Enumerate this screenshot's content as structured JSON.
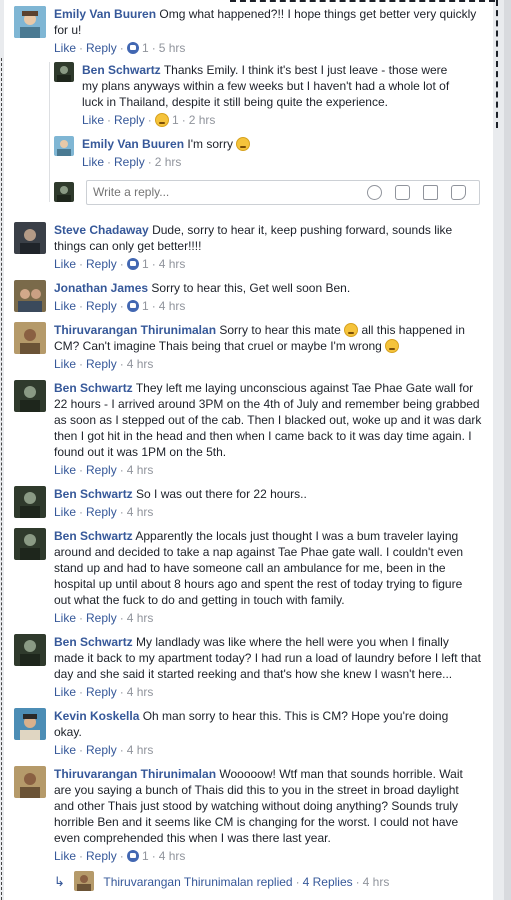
{
  "actions": {
    "like": "Like",
    "reply": "Reply"
  },
  "comments": [
    {
      "name": "Emily Van Buuren",
      "text": "Omg what happened?!! I hope things get better very quickly for u!",
      "likes": "1",
      "time": "5 hrs",
      "avatar_color": "#6aa6c8"
    },
    {
      "name": "Ben Schwartz",
      "text": "Thanks Emily. I think it's best I just leave - those were my plans anyways within a few weeks but I haven't had a whole lot of luck in Thailand, despite it still being quite the experience.",
      "likes": "1",
      "time": "2 hrs",
      "avatar_color": "#2f3a2c"
    },
    {
      "name": "Emily Van Buuren",
      "text": "I'm sorry",
      "time": "2 hrs",
      "avatar_color": "#6aa6c8"
    },
    {
      "name": "Steve Chadaway",
      "text": "Dude, sorry to hear it, keep pushing forward, sounds like things can only get better!!!!",
      "likes": "1",
      "time": "4 hrs",
      "avatar_color": "#3a3f47"
    },
    {
      "name": "Jonathan James",
      "text": "Sorry to hear this, Get well soon Ben.",
      "likes": "1",
      "time": "4 hrs",
      "avatar_color": "#7a6a4a"
    },
    {
      "name": "Thiruvarangan Thirunimalan",
      "text_a": "Sorry to hear this mate",
      "text_b": "all this happened in CM? Can't imagine Thais being that cruel or maybe I'm wrong",
      "time": "4 hrs",
      "avatar_color": "#b59a6a"
    },
    {
      "name": "Ben Schwartz",
      "text": "They left me laying unconscious against Tae Phae Gate wall for 22 hours - I arrived around 3PM on the 4th of July and remember being grabbed as soon as I stepped out of the cab. Then I blacked out, woke up and it was dark then I got hit in the head and then when I came back to it was day time again. I found out it was 1PM on the 5th.",
      "time": "4 hrs",
      "avatar_color": "#2f3a2c"
    },
    {
      "name": "Ben Schwartz",
      "text": "So I was out there for 22 hours..",
      "time": "4 hrs",
      "avatar_color": "#2f3a2c"
    },
    {
      "name": "Ben Schwartz",
      "text": "Apparently the locals just thought I was a bum traveler laying around and decided to take a nap against Tae Phae gate wall. I couldn't even stand up and had to have someone call an ambulance for me, been in the hospital up until about 8 hours ago and spent the rest of today trying to figure out what the fuck to do and getting in touch with family.",
      "time": "4 hrs",
      "avatar_color": "#2f3a2c"
    },
    {
      "name": "Ben Schwartz",
      "text": "My landlady was like where the hell were you when I finally made it back to my apartment today? I had run a load of laundry before I left that day and she said it started reeking and that's how she knew I wasn't here...",
      "time": "4 hrs",
      "avatar_color": "#2f3a2c"
    },
    {
      "name": "Kevin Koskella",
      "text": "Oh man sorry to hear this. This is CM? Hope you're doing okay.",
      "time": "4 hrs",
      "avatar_color": "#4c8db5"
    },
    {
      "name": "Thiruvarangan Thirunimalan",
      "text": "Wooooow! Wtf man that sounds horrible. Wait are you saying a bunch of Thais did this to you in the street in broad daylight and other Thais just stood by watching without doing anything? Sounds truly horrible Ben and it seems like CM is changing for the worst. I could not have even comprehended this when I was there last year.",
      "likes": "1",
      "time": "4 hrs",
      "avatar_color": "#b59a6a"
    }
  ],
  "reply_input": {
    "placeholder": "Write a reply..."
  },
  "replied": {
    "name": "Thiruvarangan Thirunimalan",
    "verb": "replied",
    "count": "4 Replies",
    "time": "4 hrs"
  }
}
